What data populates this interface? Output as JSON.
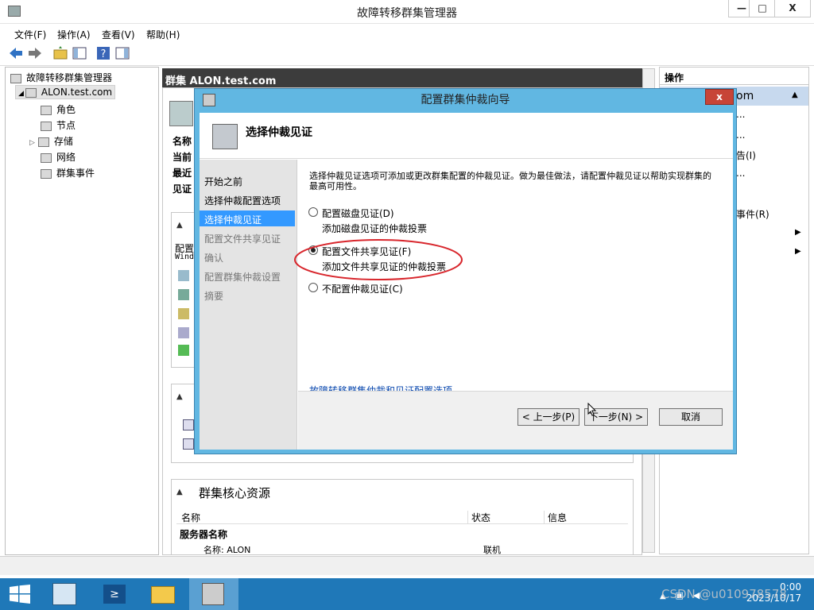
{
  "window": {
    "title": "故障转移群集管理器",
    "minimize": "—",
    "maximize": "□",
    "close": "X"
  },
  "menu": [
    "文件(F)",
    "操作(A)",
    "查看(V)",
    "帮助(H)"
  ],
  "tree": {
    "root": "故障转移群集管理器",
    "cluster": "ALON.test.com",
    "items": [
      "角色",
      "节点",
      "存储",
      "网络",
      "群集事件"
    ]
  },
  "center": {
    "header": "群集 ALON.test.com",
    "summary_labels": [
      "名称",
      "当前",
      "最近",
      "见证"
    ],
    "config_label": "配置",
    "config_sub": "Wind",
    "core_resources_title": "群集核心资源",
    "columns": [
      "名称",
      "状态",
      "信息"
    ],
    "group": "服务器名称",
    "row_name": "名称: ALON",
    "row_status": "联机"
  },
  "actions": {
    "header": "操作",
    "selected": "om",
    "items": [
      "...",
      "...",
      "告(I)",
      "...",
      "事件(R)"
    ]
  },
  "wizard": {
    "title": "配置群集仲裁向导",
    "close": "x",
    "heading": "选择仲裁见证",
    "steps": [
      {
        "label": "开始之前",
        "state": "done"
      },
      {
        "label": "选择仲裁配置选项",
        "state": "done"
      },
      {
        "label": "选择仲裁见证",
        "state": "active"
      },
      {
        "label": "配置文件共享见证",
        "state": "pending"
      },
      {
        "label": "确认",
        "state": "pending"
      },
      {
        "label": "配置群集仲裁设置",
        "state": "pending"
      },
      {
        "label": "摘要",
        "state": "pending"
      }
    ],
    "description": "选择仲裁见证选项可添加或更改群集配置的仲裁见证。做为最佳做法，请配置仲裁见证以帮助实现群集的最高可用性。",
    "options": [
      {
        "label": "配置磁盘见证(D)",
        "desc": "添加磁盘见证的仲裁投票",
        "selected": false
      },
      {
        "label": "配置文件共享见证(F)",
        "desc": "添加文件共享见证的仲裁投票",
        "selected": true
      },
      {
        "label": "不配置仲裁见证(C)",
        "desc": "",
        "selected": false
      }
    ],
    "link": "故障转移群集仲裁和见证配置选项",
    "buttons": {
      "back": "< 上一步(P)",
      "next": "下一步(N) >",
      "cancel": "取消"
    }
  },
  "taskbar": {
    "time": "0:00",
    "date": "2023/10/17"
  },
  "watermark": "CSDN @u010978578"
}
